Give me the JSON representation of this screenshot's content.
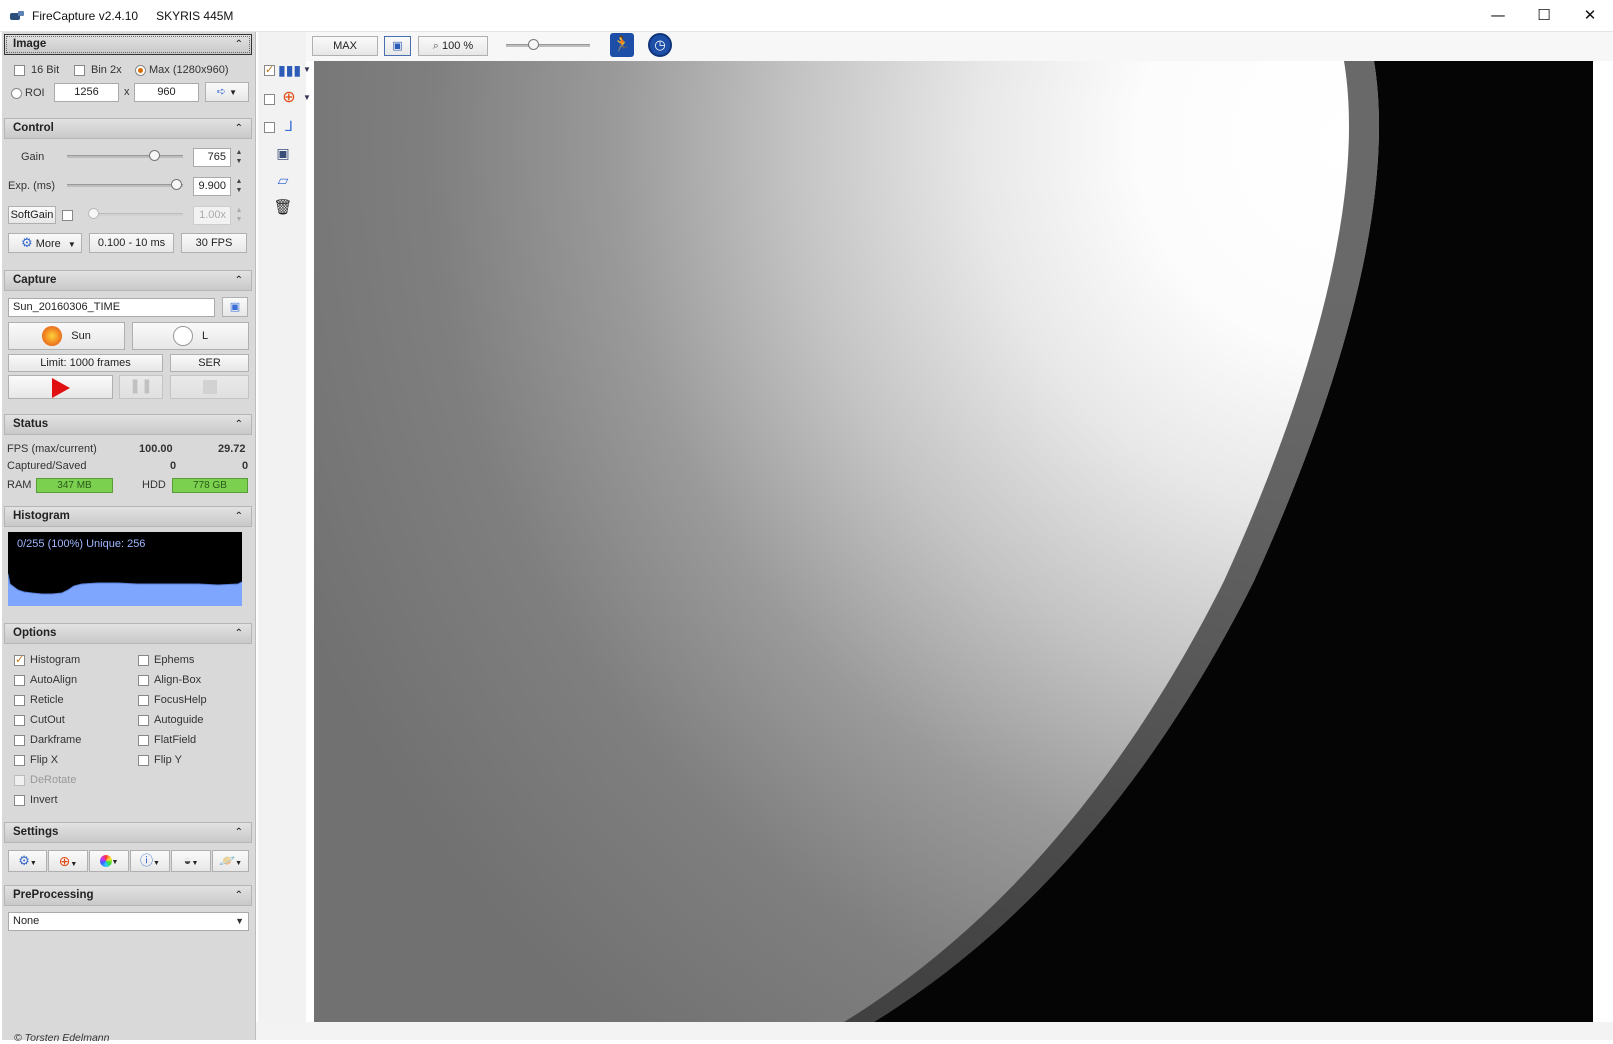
{
  "window": {
    "title": "FireCapture v2.4.10",
    "camera": "SKYRIS 445M",
    "minimize_glyph": "—",
    "maximize_glyph": "☐",
    "close_glyph": "✕"
  },
  "image": {
    "header": "Image",
    "bit16": "16 Bit",
    "bin2x": "Bin 2x",
    "max": "Max (1280x960)",
    "roi": "ROI",
    "roi_width": "1256",
    "roi_x": "x",
    "roi_height": "960"
  },
  "control": {
    "header": "Control",
    "gain_label": "Gain",
    "gain_value": "765",
    "gain_level": 0.78,
    "exp_label": "Exp. (ms)",
    "exp_value": "9.900",
    "exp_level": 0.99,
    "softgain_label": "SoftGain",
    "softgain_value": "1.00x",
    "softgain_level": 0.0,
    "more_label": "More",
    "exp_range": "0.100 - 10 ms",
    "fps_label": "30 FPS"
  },
  "capture": {
    "header": "Capture",
    "filename": "Sun_20160306_TIME",
    "sun_profile": "Sun",
    "filter": "L",
    "limit": "Limit: 1000 frames",
    "format": "SER"
  },
  "status": {
    "header": "Status",
    "fps_label": "FPS (max/current)",
    "fps_max": "100.00",
    "fps_current": "29.72",
    "captured_label": "Captured/Saved",
    "captured": "0",
    "saved": "0",
    "ram_label": "RAM",
    "ram_value": "347 MB",
    "hdd_label": "HDD",
    "hdd_value": "778 GB"
  },
  "histogram": {
    "header": "Histogram",
    "text": "0/255 (100%)  Unique: 256"
  },
  "options": {
    "header": "Options",
    "left": [
      "Histogram",
      "AutoAlign",
      "Reticle",
      "CutOut",
      "Darkframe",
      "Flip X",
      "DeRotate",
      "Invert"
    ],
    "right": [
      "Ephems",
      "Align-Box",
      "FocusHelp",
      "Autoguide",
      "FlatField",
      "Flip Y"
    ]
  },
  "settings": {
    "header": "Settings"
  },
  "preprocessing": {
    "header": "PreProcessing",
    "selected": "None"
  },
  "toolbar": {
    "max_label": "MAX",
    "zoom_label": "100 %"
  },
  "footer": {
    "copyright": "© Torsten Edelmann"
  },
  "colors": {
    "accent_orange": "#d86a00",
    "meter_green": "#7cd04f",
    "histogram_fill": "#7ea6ff"
  }
}
